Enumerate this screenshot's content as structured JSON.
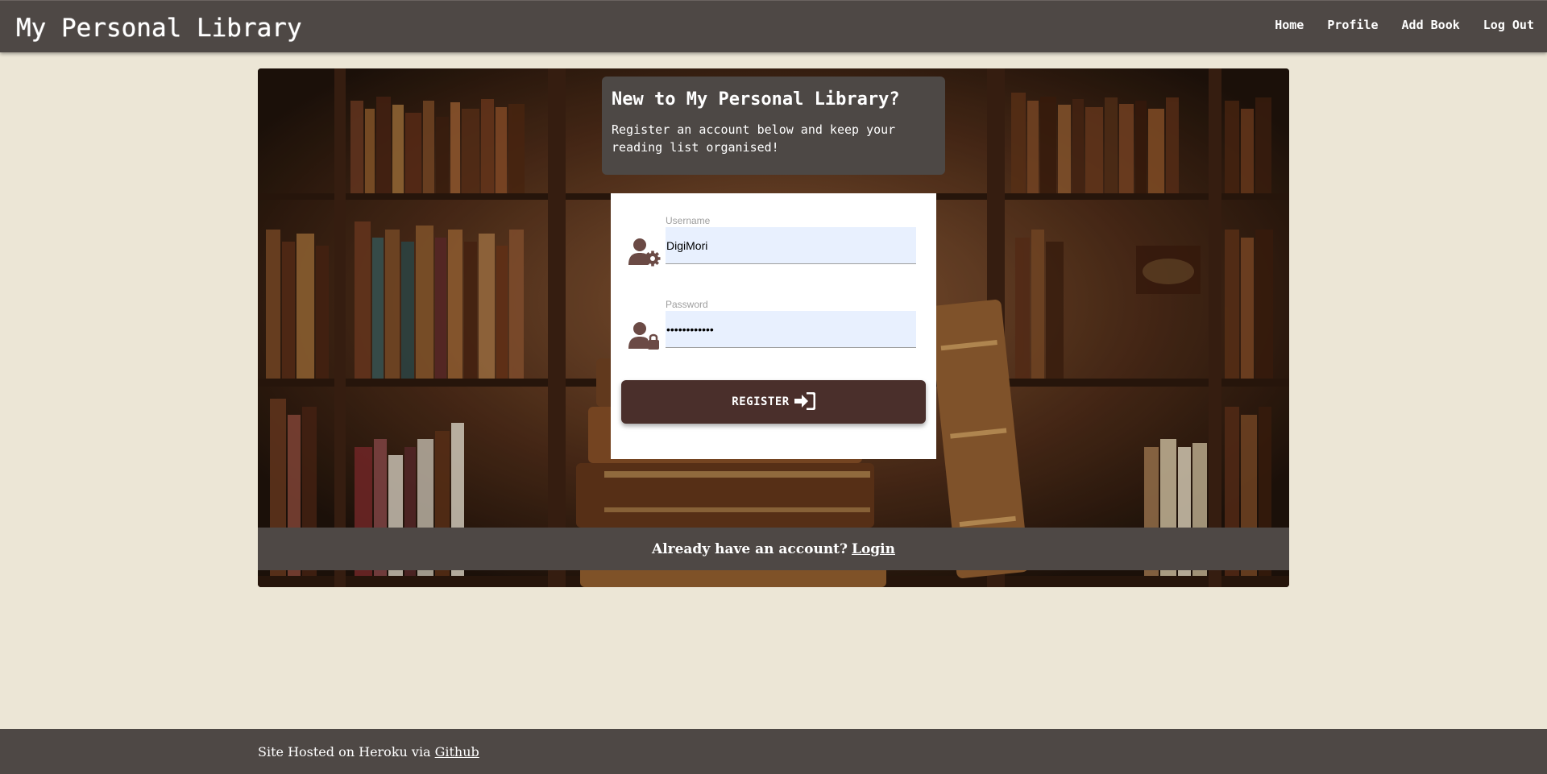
{
  "navbar": {
    "brand": "My Personal Library",
    "links": [
      {
        "label": "Home"
      },
      {
        "label": "Profile"
      },
      {
        "label": "Add Book"
      },
      {
        "label": "Log Out"
      }
    ]
  },
  "intro": {
    "title": "New to My Personal Library?",
    "text": "Register an account below and keep your reading list organised!"
  },
  "form": {
    "username": {
      "label": "Username",
      "value": "DigiMori",
      "icon": "user-cog-icon"
    },
    "password": {
      "label": "Password",
      "value": "••••••••••••",
      "icon": "user-lock-icon"
    },
    "register_label": "REGISTER",
    "register_icon": "sign-in-icon"
  },
  "login_bar": {
    "text": "Already have an account?",
    "link": "Login"
  },
  "footer": {
    "text": "Site Hosted on Heroku via",
    "link": "Github"
  },
  "colors": {
    "page_bg": "#ece6d6",
    "bar_bg": "#4e4845",
    "button_bg": "#4a2f2b",
    "icon_color": "#6b4a45",
    "input_bg": "#e8f0fe"
  }
}
